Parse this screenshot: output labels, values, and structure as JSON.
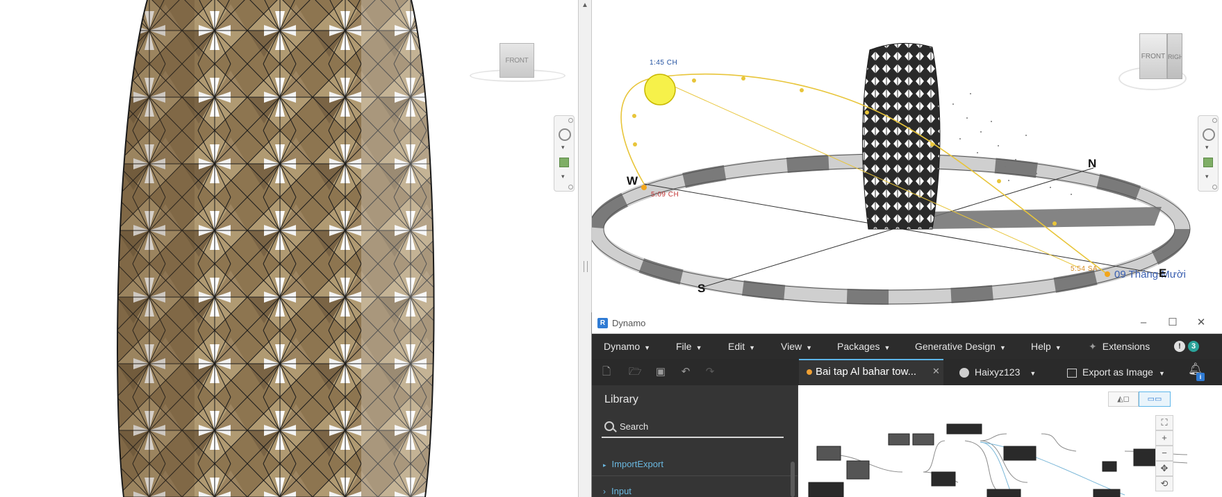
{
  "viewport_left": {
    "view_cube_label": "FRONT"
  },
  "viewport_right": {
    "view_cube_front": "FRONT",
    "view_cube_right": "RIGHT",
    "compass": {
      "w": "W",
      "n": "N",
      "s": "S",
      "e": "E"
    },
    "sun_time_current": "1:45 CH",
    "sunset_time": "5:09 CH",
    "sunrise_time": "5:54 SA",
    "date_label": "09 Tháng Mười"
  },
  "dynamo": {
    "window_title": "Dynamo",
    "menu": [
      {
        "label": "Dynamo"
      },
      {
        "label": "File"
      },
      {
        "label": "Edit"
      },
      {
        "label": "View"
      },
      {
        "label": "Packages"
      },
      {
        "label": "Generative Design"
      },
      {
        "label": "Help"
      }
    ],
    "extensions_label": "Extensions",
    "notification_count": "3",
    "workspace_tab": "Bai tap Al bahar tow...",
    "account": "Haixyz123",
    "export_label": "Export as Image",
    "bell_badge": "i",
    "library": {
      "title": "Library",
      "search_placeholder": "Search",
      "items": [
        "ImportExport",
        "Input"
      ]
    },
    "colors": {
      "accent": "#5db6ea",
      "badge_teal": "#2aa39a",
      "tab_dot": "#f0a033"
    }
  }
}
